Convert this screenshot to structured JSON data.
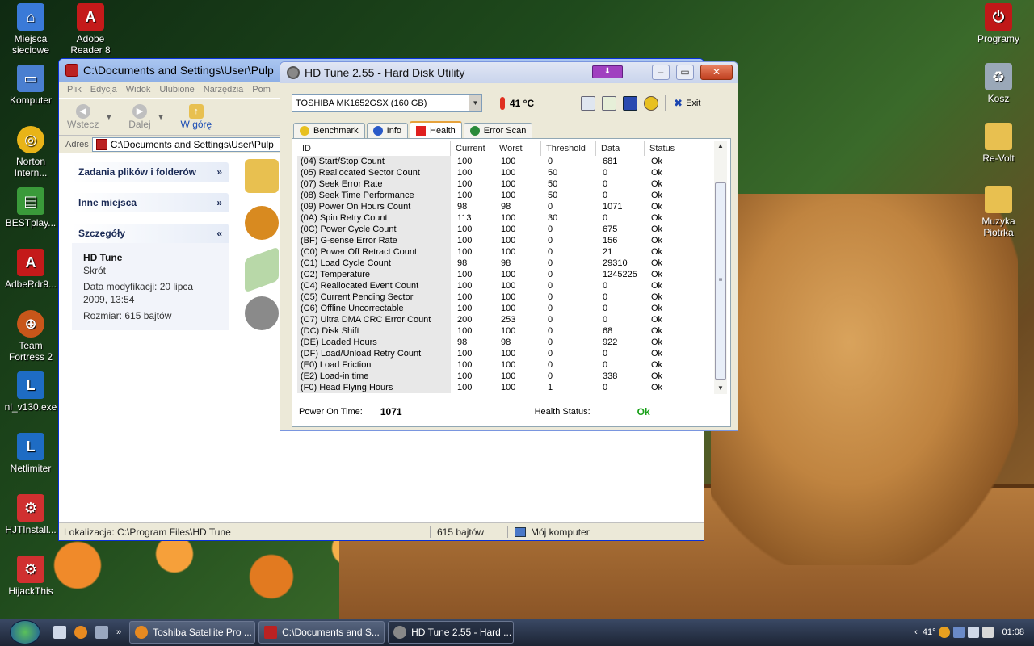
{
  "desktop": {
    "icons_left": [
      {
        "label": "Miejsca sieciowe",
        "icon": "network-places-icon"
      },
      {
        "label": "Adobe Reader 8",
        "icon": "adobe-reader-icon"
      },
      {
        "label": "Komputer",
        "icon": "computer-icon"
      },
      {
        "label": "Norton Intern...",
        "icon": "norton-icon"
      },
      {
        "label": "BESTplay...",
        "icon": "bestplayer-icon"
      },
      {
        "label": "AdbeRdr9...",
        "icon": "adobe-reader-icon"
      },
      {
        "label": "Team Fortress 2",
        "icon": "team-fortress-icon"
      },
      {
        "label": "nl_v130.exe",
        "icon": "netlimiter-icon"
      },
      {
        "label": "Netlimiter",
        "icon": "netlimiter-icon"
      },
      {
        "label": "HJTInstall...",
        "icon": "hijackthis-icon"
      },
      {
        "label": "HijackThis",
        "icon": "hijackthis-icon"
      }
    ],
    "icons_right": [
      {
        "label": "Programy",
        "icon": "power-icon"
      },
      {
        "label": "Kosz",
        "icon": "recycle-bin-icon"
      },
      {
        "label": "Re-Volt",
        "icon": "folder-icon"
      },
      {
        "label": "Muzyka Piotrka",
        "icon": "folder-icon"
      }
    ]
  },
  "explorer": {
    "title": "C:\\Documents and Settings\\User\\Pulp",
    "menu": [
      "Plik",
      "Edycja",
      "Widok",
      "Ulubione",
      "Narzędzia",
      "Pom"
    ],
    "toolbar": {
      "back": "Wstecz",
      "forward": "Dalej",
      "up": "W górę"
    },
    "address_label": "Adres",
    "address_value": "C:\\Documents and Settings\\User\\Pulp",
    "taskpane": {
      "file_tasks": "Zadania plików i folderów",
      "other_places": "Inne miejsca",
      "details": "Szczegóły",
      "detail_name": "HD Tune",
      "detail_type": "Skrót",
      "detail_modified": "Data modyfikacji: 20 lipca 2009, 13:54",
      "detail_size": "Rozmiar: 615 bajtów"
    },
    "status": {
      "location": "Lokalizacja: C:\\Program Files\\HD Tune",
      "size": "615 bajtów",
      "zone": "Mój komputer"
    }
  },
  "hdtune": {
    "title": "HD Tune 2.55 - Hard Disk Utility",
    "drive": "TOSHIBA MK1652GSX (160 GB)",
    "temperature": "41 °C",
    "exit_label": "Exit",
    "tabs": [
      "Benchmark",
      "Info",
      "Health",
      "Error Scan"
    ],
    "active_tab": "Health",
    "columns": [
      "ID",
      "Current",
      "Worst",
      "Threshold",
      "Data",
      "Status"
    ],
    "rows": [
      [
        "(04) Start/Stop Count",
        "100",
        "100",
        "0",
        "681",
        "Ok"
      ],
      [
        "(05) Reallocated Sector Count",
        "100",
        "100",
        "50",
        "0",
        "Ok"
      ],
      [
        "(07) Seek Error Rate",
        "100",
        "100",
        "50",
        "0",
        "Ok"
      ],
      [
        "(08) Seek Time Performance",
        "100",
        "100",
        "50",
        "0",
        "Ok"
      ],
      [
        "(09) Power On Hours Count",
        "98",
        "98",
        "0",
        "1071",
        "Ok"
      ],
      [
        "(0A) Spin Retry Count",
        "113",
        "100",
        "30",
        "0",
        "Ok"
      ],
      [
        "(0C) Power Cycle Count",
        "100",
        "100",
        "0",
        "675",
        "Ok"
      ],
      [
        "(BF) G-sense Error Rate",
        "100",
        "100",
        "0",
        "156",
        "Ok"
      ],
      [
        "(C0) Power Off Retract Count",
        "100",
        "100",
        "0",
        "21",
        "Ok"
      ],
      [
        "(C1) Load Cycle Count",
        "98",
        "98",
        "0",
        "29310",
        "Ok"
      ],
      [
        "(C2) Temperature",
        "100",
        "100",
        "0",
        "1245225",
        "Ok"
      ],
      [
        "(C4) Reallocated Event Count",
        "100",
        "100",
        "0",
        "0",
        "Ok"
      ],
      [
        "(C5) Current Pending Sector",
        "100",
        "100",
        "0",
        "0",
        "Ok"
      ],
      [
        "(C6) Offline Uncorrectable",
        "100",
        "100",
        "0",
        "0",
        "Ok"
      ],
      [
        "(C7) Ultra DMA CRC Error Count",
        "200",
        "253",
        "0",
        "0",
        "Ok"
      ],
      [
        "(DC) Disk Shift",
        "100",
        "100",
        "0",
        "68",
        "Ok"
      ],
      [
        "(DE) Loaded Hours",
        "98",
        "98",
        "0",
        "922",
        "Ok"
      ],
      [
        "(DF) Load/Unload Retry Count",
        "100",
        "100",
        "0",
        "0",
        "Ok"
      ],
      [
        "(E0) Load Friction",
        "100",
        "100",
        "0",
        "0",
        "Ok"
      ],
      [
        "(E2) Load-in time",
        "100",
        "100",
        "0",
        "338",
        "Ok"
      ],
      [
        "(F0) Head Flying Hours",
        "100",
        "100",
        "1",
        "0",
        "Ok"
      ]
    ],
    "power_on_label": "Power On Time:",
    "power_on_value": "1071",
    "health_label": "Health Status:",
    "health_value": "Ok"
  },
  "taskbar": {
    "tasks": [
      {
        "label": "Toshiba Satellite Pro ...",
        "icon": "firefox-icon"
      },
      {
        "label": "C:\\Documents and S...",
        "icon": "explorer-window-icon"
      },
      {
        "label": "HD Tune 2.55 - Hard ...",
        "icon": "hdtune-icon"
      }
    ],
    "tray_temp": "41°",
    "clock": "01:08"
  },
  "colors": {
    "accent": "#0831d9",
    "ok_green": "#18a018",
    "taskbar": "#1c2434"
  }
}
